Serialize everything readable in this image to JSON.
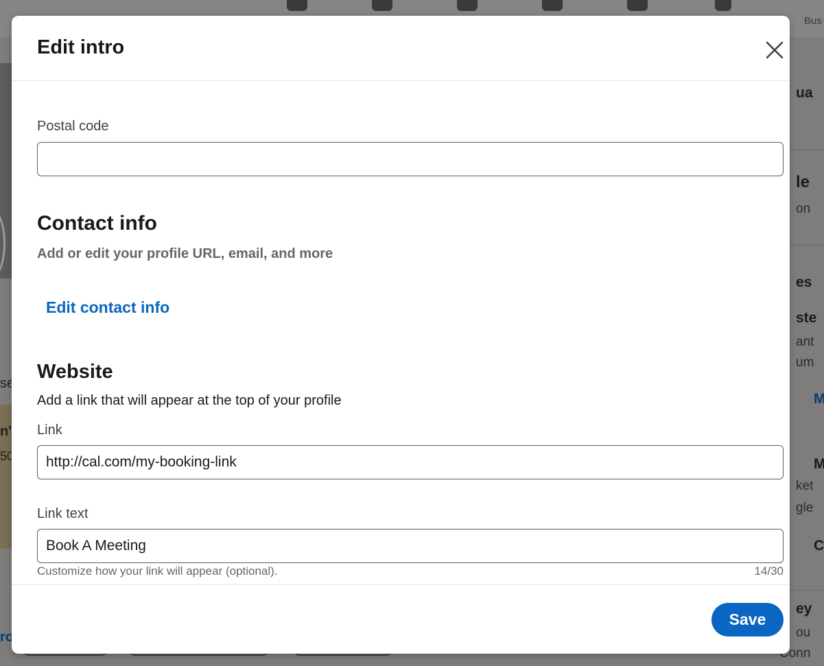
{
  "background": {
    "right_texts": [
      "ua",
      "le",
      "on",
      "es",
      "ste",
      "ant",
      "um",
      "M",
      "M",
      "ket",
      "gle",
      "C",
      "ey",
      "ou",
      "Conn"
    ],
    "left_texts": [
      "se",
      "n'",
      "50",
      "ro"
    ],
    "top_right_text": "Bus"
  },
  "modal": {
    "title": "Edit intro",
    "close_label": "×",
    "postal_code": {
      "label": "Postal code",
      "value": ""
    },
    "contact_info": {
      "title": "Contact info",
      "subtitle": "Add or edit your profile URL, email, and more",
      "edit_link": "Edit contact info"
    },
    "website": {
      "title": "Website",
      "description": "Add a link that will appear at the top of your profile",
      "link_label": "Link",
      "link_value": "http://cal.com/my-booking-link",
      "link_text_label": "Link text",
      "link_text_value": "Book A Meeting",
      "helper": "Customize how your link will appear (optional).",
      "counter": "14/30"
    },
    "save_label": "Save"
  },
  "colors": {
    "accent": "#0a66c2",
    "text_primary": "#191919",
    "text_secondary": "#666666",
    "overlay": "#7c7b79"
  }
}
